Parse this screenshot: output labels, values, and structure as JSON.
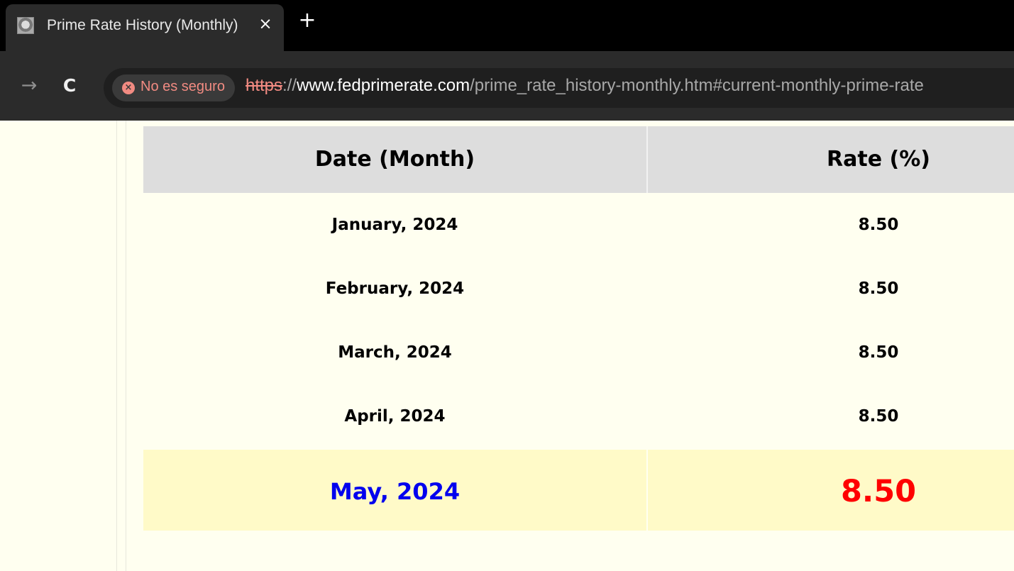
{
  "browser": {
    "tab": {
      "title": "Prime Rate History (Monthly)",
      "close_glyph": "×",
      "favicon": "site-favicon"
    },
    "new_tab_glyph": "+",
    "toolbar": {
      "forward_glyph": "→",
      "reload_glyph": "C",
      "security_label": "No es seguro",
      "security_icon_glyph": "×",
      "url": {
        "scheme": "https",
        "separator": "://",
        "host": "www.fedprimerate.com",
        "path": "/prime_rate_history-monthly.htm#current-monthly-prime-rate"
      }
    }
  },
  "table": {
    "headers": {
      "date": "Date (Month)",
      "rate": "Rate (%)"
    },
    "rows": [
      {
        "date": "January, 2024",
        "rate": "8.50"
      },
      {
        "date": "February, 2024",
        "rate": "8.50"
      },
      {
        "date": "March, 2024",
        "rate": "8.50"
      },
      {
        "date": "April, 2024",
        "rate": "8.50"
      }
    ],
    "current": {
      "date": "May, 2024",
      "rate": "8.50"
    }
  },
  "colors": {
    "current_date": "#0000ee",
    "current_rate": "#ff0000",
    "page_background": "#fffff0",
    "header_background": "#dddddd",
    "current_row_background": "#fffac8"
  }
}
